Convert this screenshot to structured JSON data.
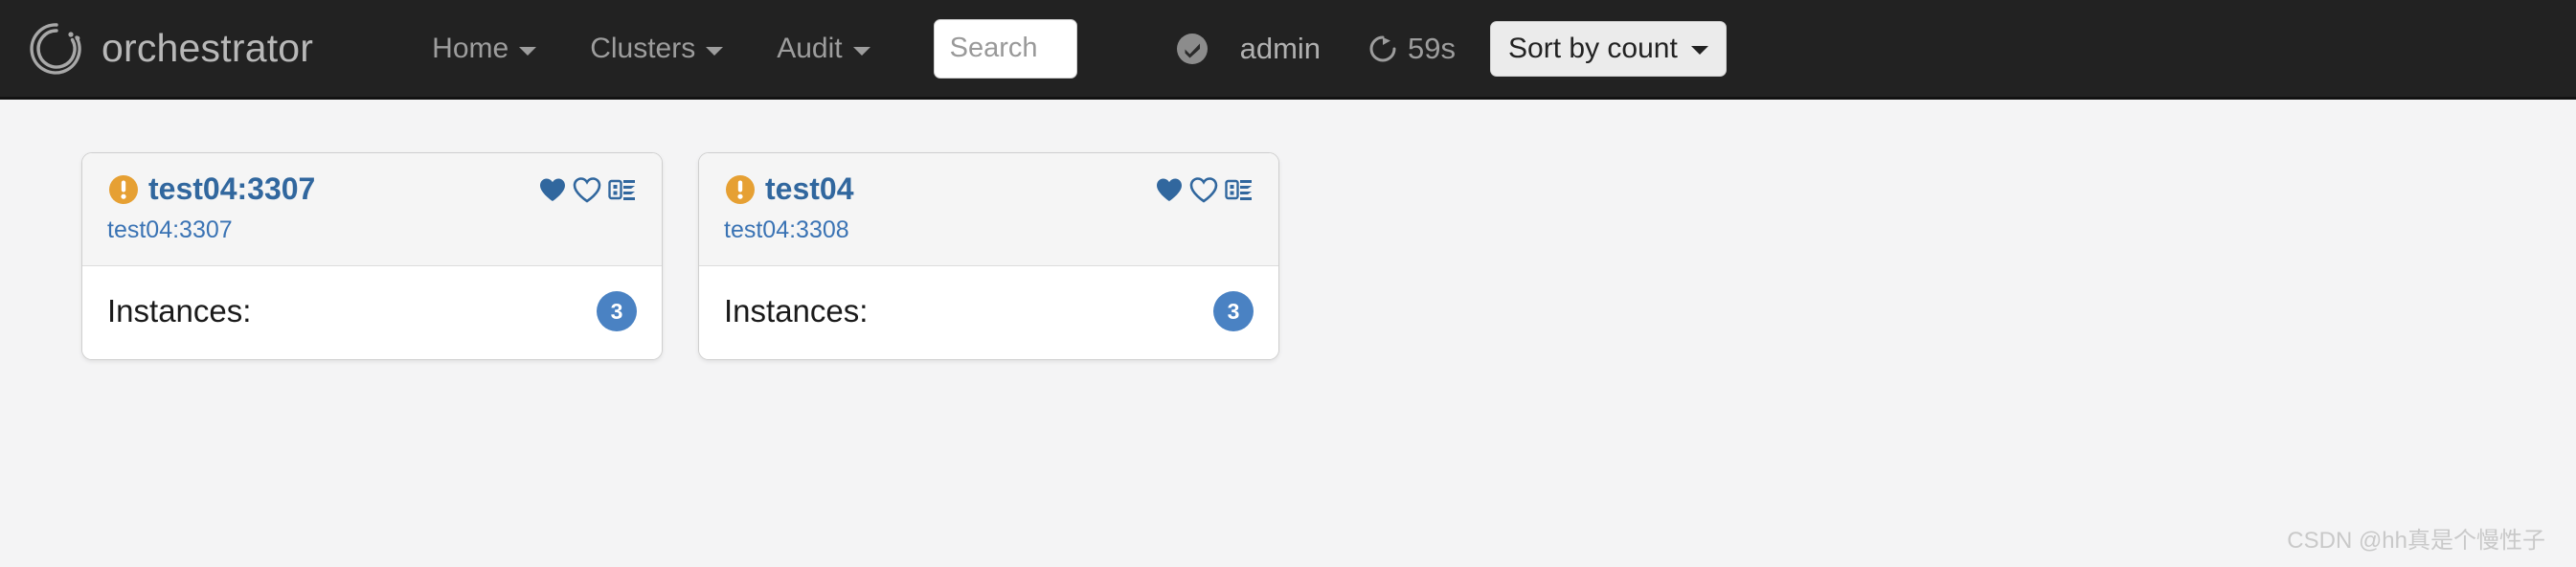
{
  "navbar": {
    "brand": {
      "name": "orchestrator",
      "logo_icon": "orchestrator-ring-logo"
    },
    "links": [
      {
        "label": "Home",
        "icon": "chevron-down-icon"
      },
      {
        "label": "Clusters",
        "icon": "chevron-down-icon"
      },
      {
        "label": "Audit",
        "icon": "chevron-down-icon"
      }
    ],
    "search": {
      "value": "",
      "placeholder": "Search"
    },
    "status": {
      "icon": "check-badge-icon"
    },
    "user": "admin",
    "refresh": {
      "icon": "refresh-icon",
      "label": "59s"
    },
    "sort": {
      "label": "Sort by count",
      "icon": "chevron-down-icon"
    }
  },
  "cards": [
    {
      "status_icon": "warning-exclamation-icon",
      "title": "test04:3307",
      "subtitle": "test04:3307",
      "actions": [
        {
          "icon": "heart-filled-icon"
        },
        {
          "icon": "heart-outline-icon"
        },
        {
          "icon": "server-stack-icon"
        }
      ],
      "body_label": "Instances:",
      "count": "3"
    },
    {
      "status_icon": "warning-exclamation-icon",
      "title": "test04",
      "subtitle": "test04:3308",
      "actions": [
        {
          "icon": "heart-filled-icon"
        },
        {
          "icon": "heart-outline-icon"
        },
        {
          "icon": "server-stack-icon"
        }
      ],
      "body_label": "Instances:",
      "count": "3"
    }
  ],
  "watermark": "CSDN @hh真是个慢性子",
  "colors": {
    "navbar_bg": "#222222",
    "page_bg": "#f4f4f5",
    "link_blue": "#31679e",
    "warning_orange": "#e6a033",
    "badge_blue": "#4a82c3"
  }
}
